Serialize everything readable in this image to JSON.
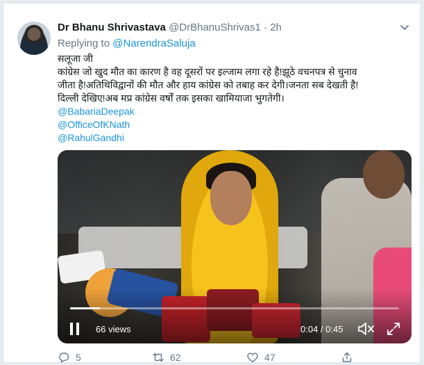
{
  "tweet": {
    "author_name": "Dr Bhanu Shrivastava",
    "handle": "@DrBhanuShrivas1",
    "separator": "·",
    "time": "2h",
    "replying_to_label": "Replying to",
    "replying_to_handle": "@NarendraSaluja",
    "lines": [
      "सलूजा जी",
      "कांग्रेस जो खुद मौत का कारण है वह दूसरों पर इल्जाम लगा रहे है!झूठे वचनपत्र से चुनाव",
      "जीता है!अतिथिविद्वानों की मौत और हाय कांग्रेस को तबाह कर देगी।जनता सब देखती है!",
      "दिल्ली देखिए!अब मप्र कांग्रेस वर्षों तक इसका खामियाजा भुगतेगी।"
    ],
    "mentions": [
      "@BabariaDeepak",
      "@OfficeOfKNath",
      "@RahulGandhi"
    ]
  },
  "video": {
    "views": "66 views",
    "time": "0:04 / 0:45",
    "progress": 0.09
  },
  "actions": {
    "replies": "5",
    "retweets": "62",
    "likes": "47"
  },
  "icons": [
    "caret-down-icon",
    "pause-icon",
    "mute-icon",
    "fullscreen-icon",
    "reply-icon",
    "retweet-icon",
    "like-icon",
    "share-icon"
  ],
  "colors": {
    "link": "#1b95e0",
    "muted": "#657786",
    "text": "#14171a"
  }
}
